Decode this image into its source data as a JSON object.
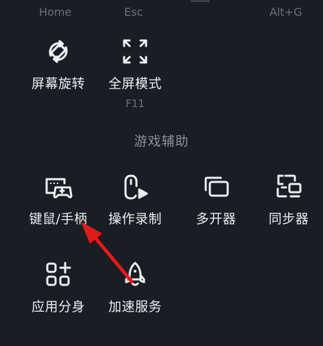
{
  "top_shortcuts": [
    {
      "label": "Home"
    },
    {
      "label": "Esc"
    },
    {
      "label": "Alt+G"
    }
  ],
  "row1": [
    {
      "label": "屏幕旋转",
      "icon": "screen-rotate-icon",
      "shortcut": ""
    },
    {
      "label": "全屏模式",
      "icon": "fullscreen-icon",
      "shortcut": "F11"
    }
  ],
  "section": {
    "title": "游戏辅助"
  },
  "game_tools": [
    {
      "label": "键鼠/手柄",
      "icon": "keyboard-gamepad-icon"
    },
    {
      "label": "操作录制",
      "icon": "operation-record-icon"
    },
    {
      "label": "多开器",
      "icon": "multi-instance-icon"
    },
    {
      "label": "同步器",
      "icon": "synchronizer-icon"
    },
    {
      "label": "应用分身",
      "icon": "app-clone-icon"
    },
    {
      "label": "加速服务",
      "icon": "rocket-icon"
    }
  ],
  "annotation": {
    "arrow_color": "#e01b1b",
    "points_to": "键鼠/手柄"
  }
}
